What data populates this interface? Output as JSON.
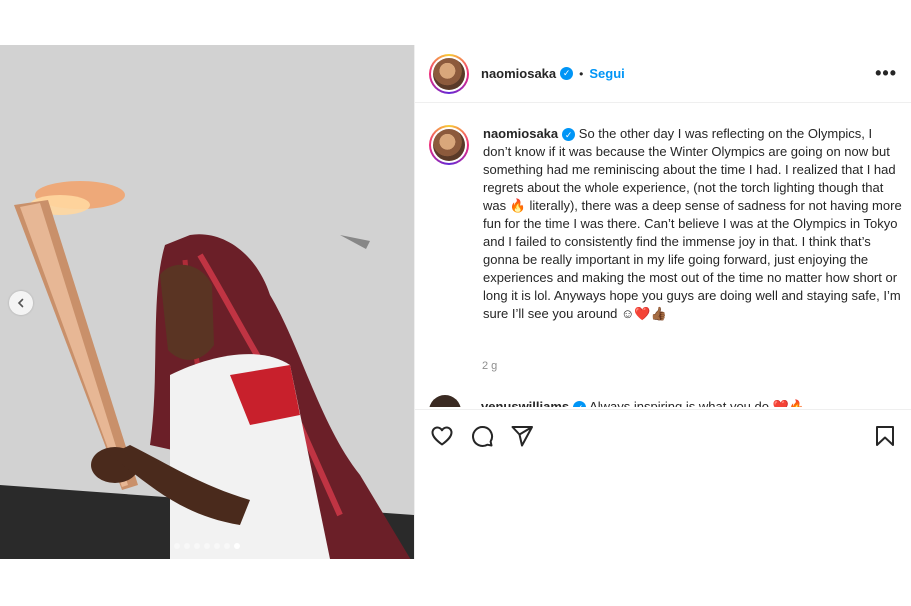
{
  "post": {
    "author": "naomiosaka",
    "follow_label": "Segui",
    "separator": "•",
    "more_label": "•••",
    "caption": "So the other day I was reflecting on the Olympics, I don’t know if it was because the Winter Olympics are going on now but something had me reminiscing about the time I had. I realized that I had regrets about the whole experience, (not the torch lighting though that was 🔥 literally), there was a deep sense of sadness for not having more fun for the time I was there. Can’t believe I was at the Olympics in Tokyo and I failed to consistently find the immense joy in that. I think that’s gonna be really important in my life going forward, just enjoying the experiences and making the most out of the time no matter how short or long it is lol. Anyways hope you guys are doing well and staying safe, I’m sure I’ll see you around ☺❤️👍🏾",
    "time_ago": "2 g",
    "carousel": {
      "total": 7,
      "active_index": 6
    }
  },
  "comment_peek": {
    "username": "venuswilliams",
    "text": "Always inspiring is what you do ❤️🔥"
  },
  "icons": {
    "like": "heart-icon",
    "comment": "comment-bubble-icon",
    "share": "paper-plane-icon",
    "save": "bookmark-icon",
    "verified": "verified-badge-icon",
    "prev": "chevron-left-icon"
  },
  "colors": {
    "link_blue": "#0095f6",
    "text": "#262626",
    "muted": "#8e8e8e",
    "border": "#efefef"
  }
}
